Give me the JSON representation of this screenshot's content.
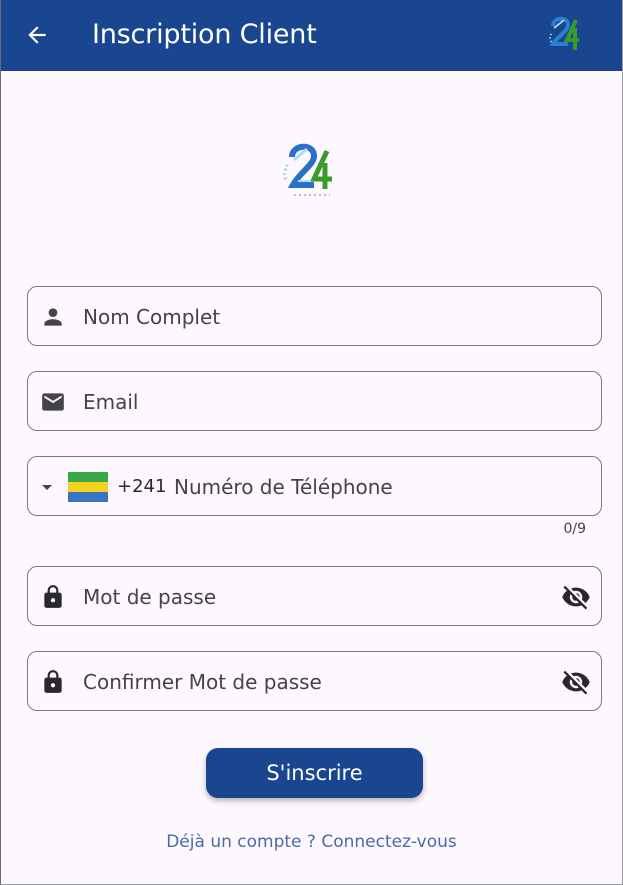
{
  "appbar": {
    "title": "Inscription Client",
    "background_color": "#1a4690",
    "back_icon": "arrow-left-icon",
    "logo": "app-logo-24"
  },
  "center_logo": "app-logo-24",
  "form": {
    "full_name": {
      "placeholder": "Nom Complet",
      "icon": "person-icon"
    },
    "email": {
      "placeholder": "Email",
      "icon": "mail-icon"
    },
    "phone": {
      "placeholder": "Numéro de Téléphone",
      "dial_code": "+241",
      "country_flag": "gabon-flag",
      "counter": "0/9",
      "dropdown_icon": "arrow-drop-down-icon"
    },
    "password": {
      "placeholder": "Mot de passe",
      "icon": "lock-icon",
      "toggle_icon": "visibility-off-icon"
    },
    "confirm_password": {
      "placeholder": "Confirmer Mot de passe",
      "icon": "lock-icon",
      "toggle_icon": "visibility-off-icon"
    }
  },
  "submit_label": "S'inscrire",
  "login_link": "Déjà un compte ? Connectez-vous",
  "colors": {
    "primary": "#1a4690",
    "field_border": "#7c7a80",
    "link": "#4a6aa8",
    "background": "#fdf8fd"
  }
}
